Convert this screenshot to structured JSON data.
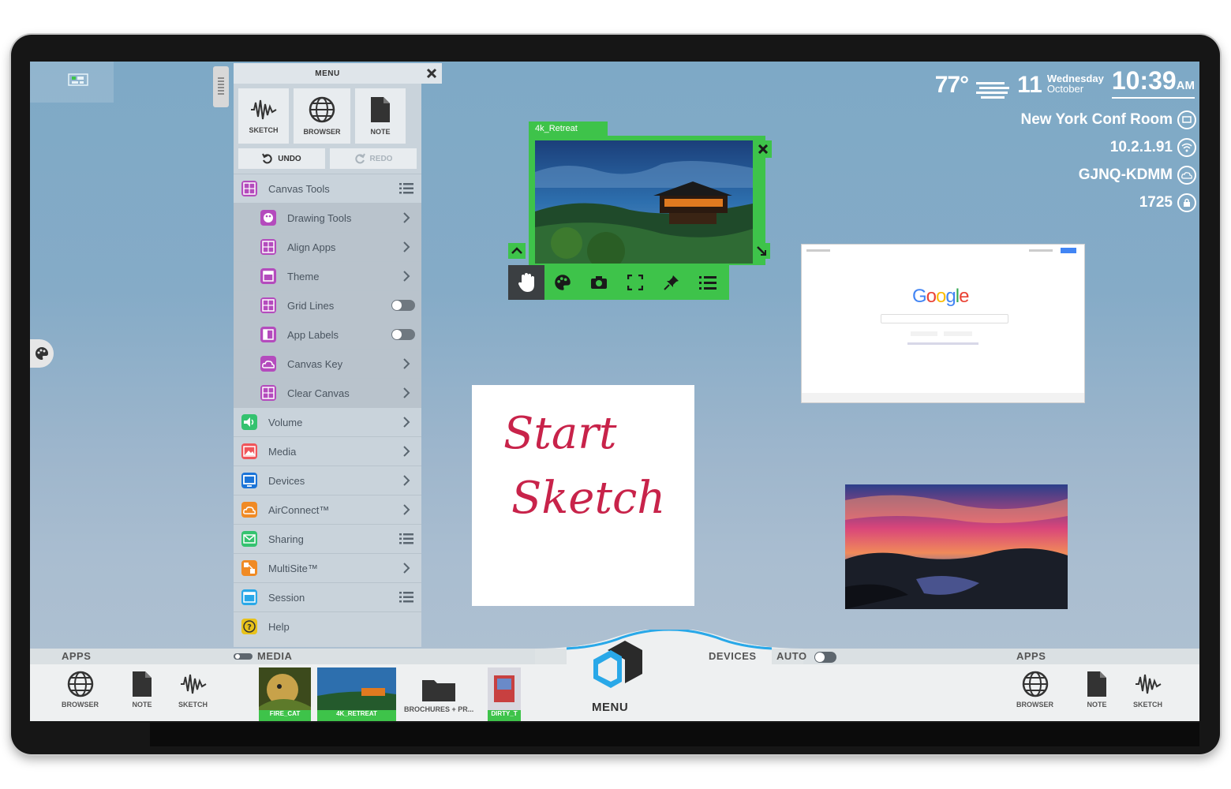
{
  "status": {
    "temperature": "77°",
    "day_number": "11",
    "weekday": "Wednesday",
    "month": "October",
    "time": "10:39",
    "ampm": "AM",
    "room": "New York Conf Room",
    "ip": "10.2.1.91",
    "network": "GJNQ-KDMM",
    "pin": "1725"
  },
  "menu": {
    "title": "MENU",
    "quick": [
      {
        "label": "SKETCH",
        "icon": "sketch-icon"
      },
      {
        "label": "BROWSER",
        "icon": "globe-icon"
      },
      {
        "label": "NOTE",
        "icon": "note-icon"
      }
    ],
    "undo_label": "UNDO",
    "redo_label": "REDO",
    "items": [
      {
        "label": "Canvas Tools",
        "icon": "grid-icon",
        "color": "#b44bbd",
        "tail": "list",
        "sub": false
      },
      {
        "label": "Drawing Tools",
        "icon": "palette-icon",
        "color": "#b44bbd",
        "tail": "chevron",
        "sub": true
      },
      {
        "label": "Align Apps",
        "icon": "grid-icon",
        "color": "#b44bbd",
        "tail": "chevron",
        "sub": true
      },
      {
        "label": "Theme",
        "icon": "theme-icon",
        "color": "#b44bbd",
        "tail": "chevron",
        "sub": true
      },
      {
        "label": "Grid Lines",
        "icon": "grid-icon",
        "color": "#b44bbd",
        "tail": "toggle",
        "sub": true
      },
      {
        "label": "App Labels",
        "icon": "label-icon",
        "color": "#b44bbd",
        "tail": "toggle",
        "sub": true
      },
      {
        "label": "Canvas Key",
        "icon": "cloud-icon",
        "color": "#b44bbd",
        "tail": "chevron",
        "sub": true
      },
      {
        "label": "Clear Canvas",
        "icon": "grid-icon",
        "color": "#b44bbd",
        "tail": "chevron",
        "sub": true
      },
      {
        "label": "Volume",
        "icon": "volume-icon",
        "color": "#34c26f",
        "tail": "chevron",
        "sub": false
      },
      {
        "label": "Media",
        "icon": "image-icon",
        "color": "#f0555a",
        "tail": "chevron",
        "sub": false
      },
      {
        "label": "Devices",
        "icon": "monitor-icon",
        "color": "#1b74d8",
        "tail": "chevron",
        "sub": false
      },
      {
        "label": "AirConnect™",
        "icon": "cloud-icon",
        "color": "#f08a24",
        "tail": "chevron",
        "sub": false
      },
      {
        "label": "Sharing",
        "icon": "share-icon",
        "color": "#34c26f",
        "tail": "list",
        "sub": false
      },
      {
        "label": "MultiSite™",
        "icon": "multisite-icon",
        "color": "#f08a24",
        "tail": "chevron",
        "sub": false
      },
      {
        "label": "Session",
        "icon": "session-icon",
        "color": "#29a8e8",
        "tail": "list",
        "sub": false
      },
      {
        "label": "Help",
        "icon": "help-icon",
        "color": "#e8c21a",
        "tail": "none",
        "sub": false
      }
    ]
  },
  "image_window": {
    "title": "4k_Retreat"
  },
  "browser_window": {
    "logo": "Google"
  },
  "sketch": {
    "line1": "Start",
    "line2": "Sketch"
  },
  "dock": {
    "apps_left_label": "APPS",
    "media_label": "MEDIA",
    "devices_label": "DEVICES",
    "auto_label": "AUTO",
    "apps_right_label": "APPS",
    "menu_label": "MENU",
    "apps_left": [
      {
        "label": "BROWSER",
        "icon": "globe-icon"
      },
      {
        "label": "NOTE",
        "icon": "note-icon"
      },
      {
        "label": "SKETCH",
        "icon": "sketch-icon"
      }
    ],
    "media": [
      {
        "label": "FIRE_CAT"
      },
      {
        "label": "4K_RETREAT"
      },
      {
        "label": "BROCHURES + PR..."
      },
      {
        "label": "DIRTY_T"
      }
    ],
    "apps_right": [
      {
        "label": "BROWSER",
        "icon": "globe-icon"
      },
      {
        "label": "NOTE",
        "icon": "note-icon"
      },
      {
        "label": "SKETCH",
        "icon": "sketch-icon"
      }
    ]
  },
  "colors": {
    "accent_green": "#3ec34a",
    "menu_bg": "#c9d3db",
    "sketch_ink": "#c8234a"
  }
}
